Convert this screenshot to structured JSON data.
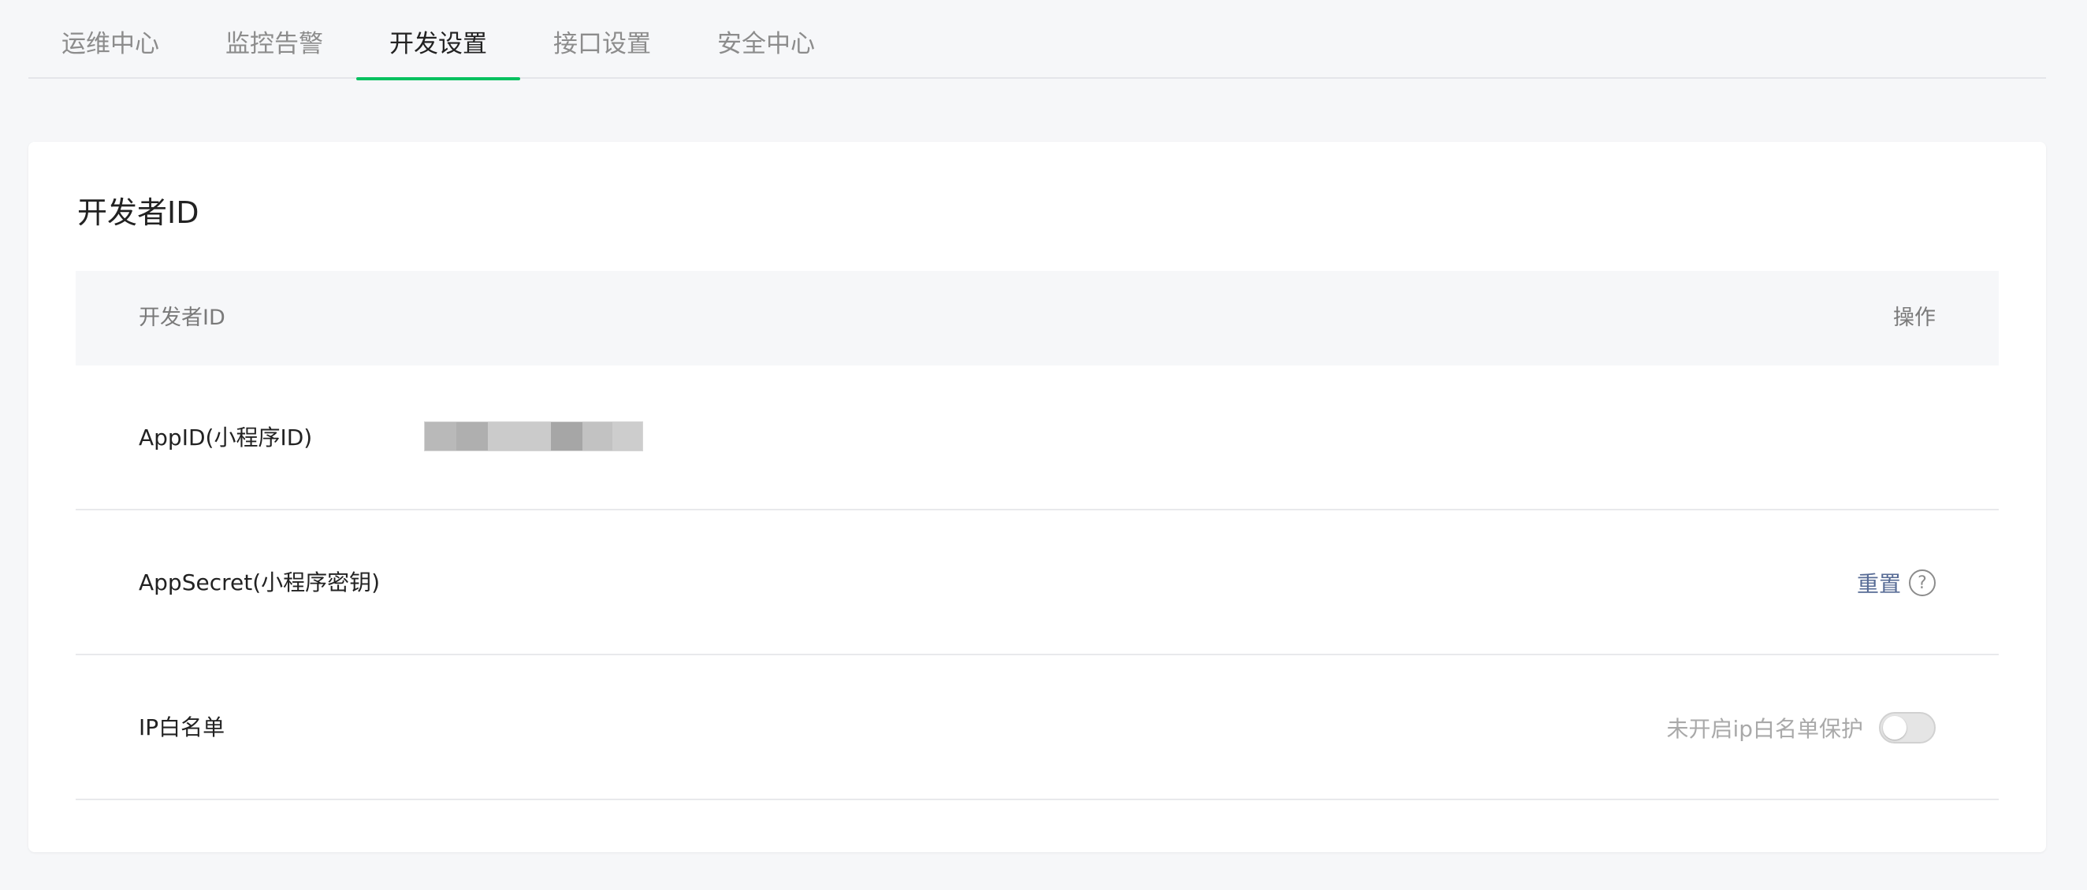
{
  "tabs": [
    {
      "label": "运维中心",
      "active": false
    },
    {
      "label": "监控告警",
      "active": false
    },
    {
      "label": "开发设置",
      "active": true
    },
    {
      "label": "接口设置",
      "active": false
    },
    {
      "label": "安全中心",
      "active": false
    }
  ],
  "section": {
    "title": "开发者ID",
    "table": {
      "header_left": "开发者ID",
      "header_right": "操作"
    },
    "rows": {
      "appid": {
        "label": "AppID(小程序ID)"
      },
      "appsecret": {
        "label": "AppSecret(小程序密钥)",
        "action_label": "重置",
        "help_icon": "?"
      },
      "ip_whitelist": {
        "label": "IP白名单",
        "status_text": "未开启ip白名单保护",
        "toggle_on": false
      }
    }
  },
  "colors": {
    "accent": "#07c160",
    "link": "#576b95",
    "background": "#f6f7f9"
  }
}
